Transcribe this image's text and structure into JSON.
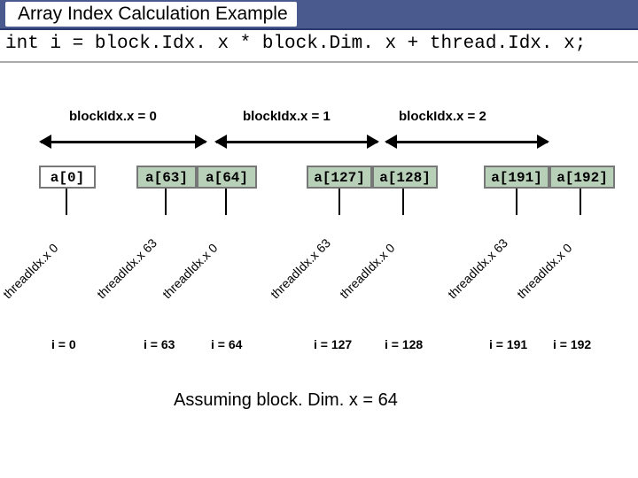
{
  "title": "Array Index Calculation Example",
  "code": "int i = block.Idx. x * block.Dim. x + thread.Idx. x;",
  "blocks": {
    "b0": "blockIdx.x = 0",
    "b1": "blockIdx.x  = 1",
    "b2": "blockIdx.x  = 2"
  },
  "cells": {
    "a0": "a[0]",
    "a63": "a[63]",
    "a64": "a[64]",
    "a127": "a[127]",
    "a128": "a[128]",
    "a191": "a[191]",
    "a192": "a[192]"
  },
  "threads": {
    "t0a": "threadIdx.x 0",
    "t63a": "threadIdx.x 63",
    "t0b": "threadIdx.x 0",
    "t63b": "threadIdx.x 63",
    "t0c": "threadIdx.x 0",
    "t63c": "threadIdx.x 63",
    "t0d": "threadIdx.x 0"
  },
  "indices": {
    "i0": "i = 0",
    "i63": "i = 63",
    "i64": "i = 64",
    "i127": "i = 127",
    "i128": "i = 128",
    "i191": "i = 191",
    "i192": "i = 192"
  },
  "footer": "Assuming block. Dim. x = 64"
}
